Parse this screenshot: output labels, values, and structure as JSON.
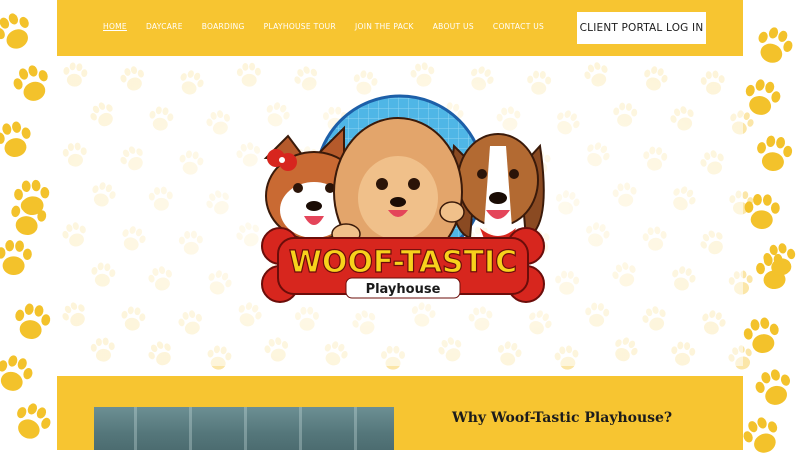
{
  "nav": {
    "items": [
      {
        "label": "HOME",
        "active": true
      },
      {
        "label": "DAYCARE"
      },
      {
        "label": "BOARDING"
      },
      {
        "label": "PLAYHOUSE TOUR"
      },
      {
        "label": "JOIN THE PACK"
      },
      {
        "label": "ABOUT US"
      },
      {
        "label": "CONTACT US"
      }
    ],
    "portal_button": "CLIENT PORTAL LOG IN"
  },
  "logo": {
    "title": "WOOF-TASTIC",
    "subtitle": "Playhouse"
  },
  "section": {
    "heading": "Why Woof-Tastic Playhouse?"
  },
  "colors": {
    "brand_yellow": "#f7c531",
    "paw_light": "#fbe6a8",
    "paw_dark": "#f3c22b",
    "logo_red": "#d7261e",
    "logo_yellow": "#f7d21c"
  }
}
